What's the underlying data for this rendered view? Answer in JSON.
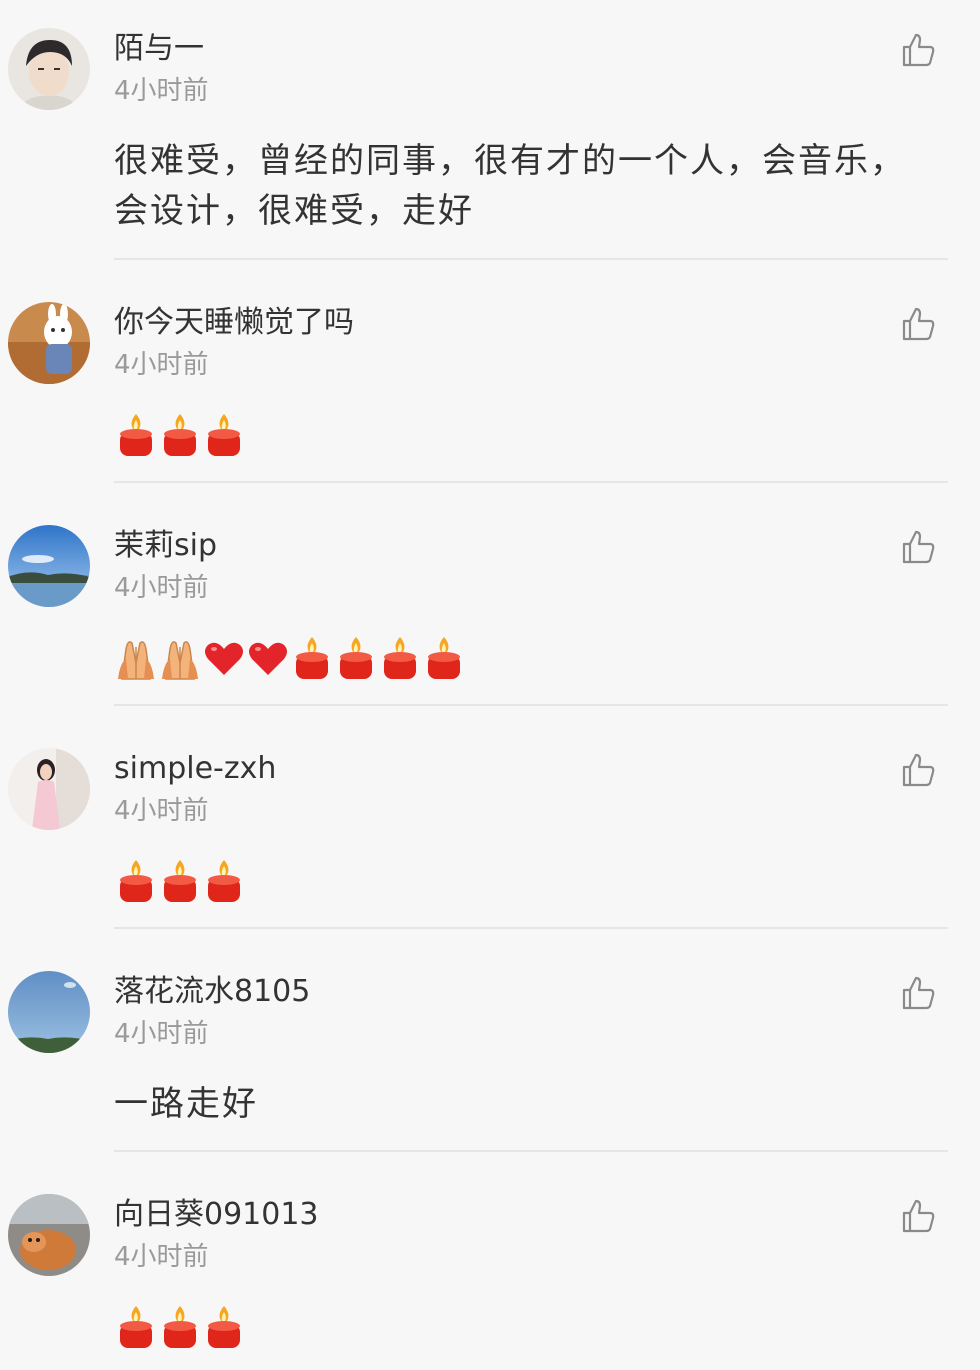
{
  "comments": [
    {
      "username": "陌与一",
      "time": "4小时前",
      "text_lines": [
        "很难受，曾经的同事，很有才的一个人，会音乐，",
        "会设计，很难受，走好"
      ],
      "emojis": []
    },
    {
      "username": "你今天睡懒觉了吗",
      "time": "4小时前",
      "text_lines": [],
      "emojis": [
        "candle-icon",
        "candle-icon",
        "candle-icon"
      ]
    },
    {
      "username": "茉莉sip",
      "time": "4小时前",
      "text_lines": [],
      "emojis": [
        "pray-hands-icon",
        "pray-hands-icon",
        "heart-icon",
        "heart-icon",
        "candle-icon",
        "candle-icon",
        "candle-icon",
        "candle-icon"
      ]
    },
    {
      "username": "simple-zxh",
      "time": "4小时前",
      "text_lines": [],
      "emojis": [
        "candle-icon",
        "candle-icon",
        "candle-icon"
      ]
    },
    {
      "username": "落花流水8105",
      "time": "4小时前",
      "text_lines": [
        "一路走好"
      ],
      "emojis": []
    },
    {
      "username": "向日葵091013",
      "time": "4小时前",
      "text_lines": [],
      "emojis": [
        "candle-icon",
        "candle-icon",
        "candle-icon"
      ]
    }
  ],
  "icons": {
    "like": "thumbs-up-icon"
  },
  "colors": {
    "username": "#333333",
    "time": "#9a9a9a",
    "divider": "#e6e6e6",
    "candle_red": "#e0261b",
    "heart_red": "#e3242b"
  }
}
